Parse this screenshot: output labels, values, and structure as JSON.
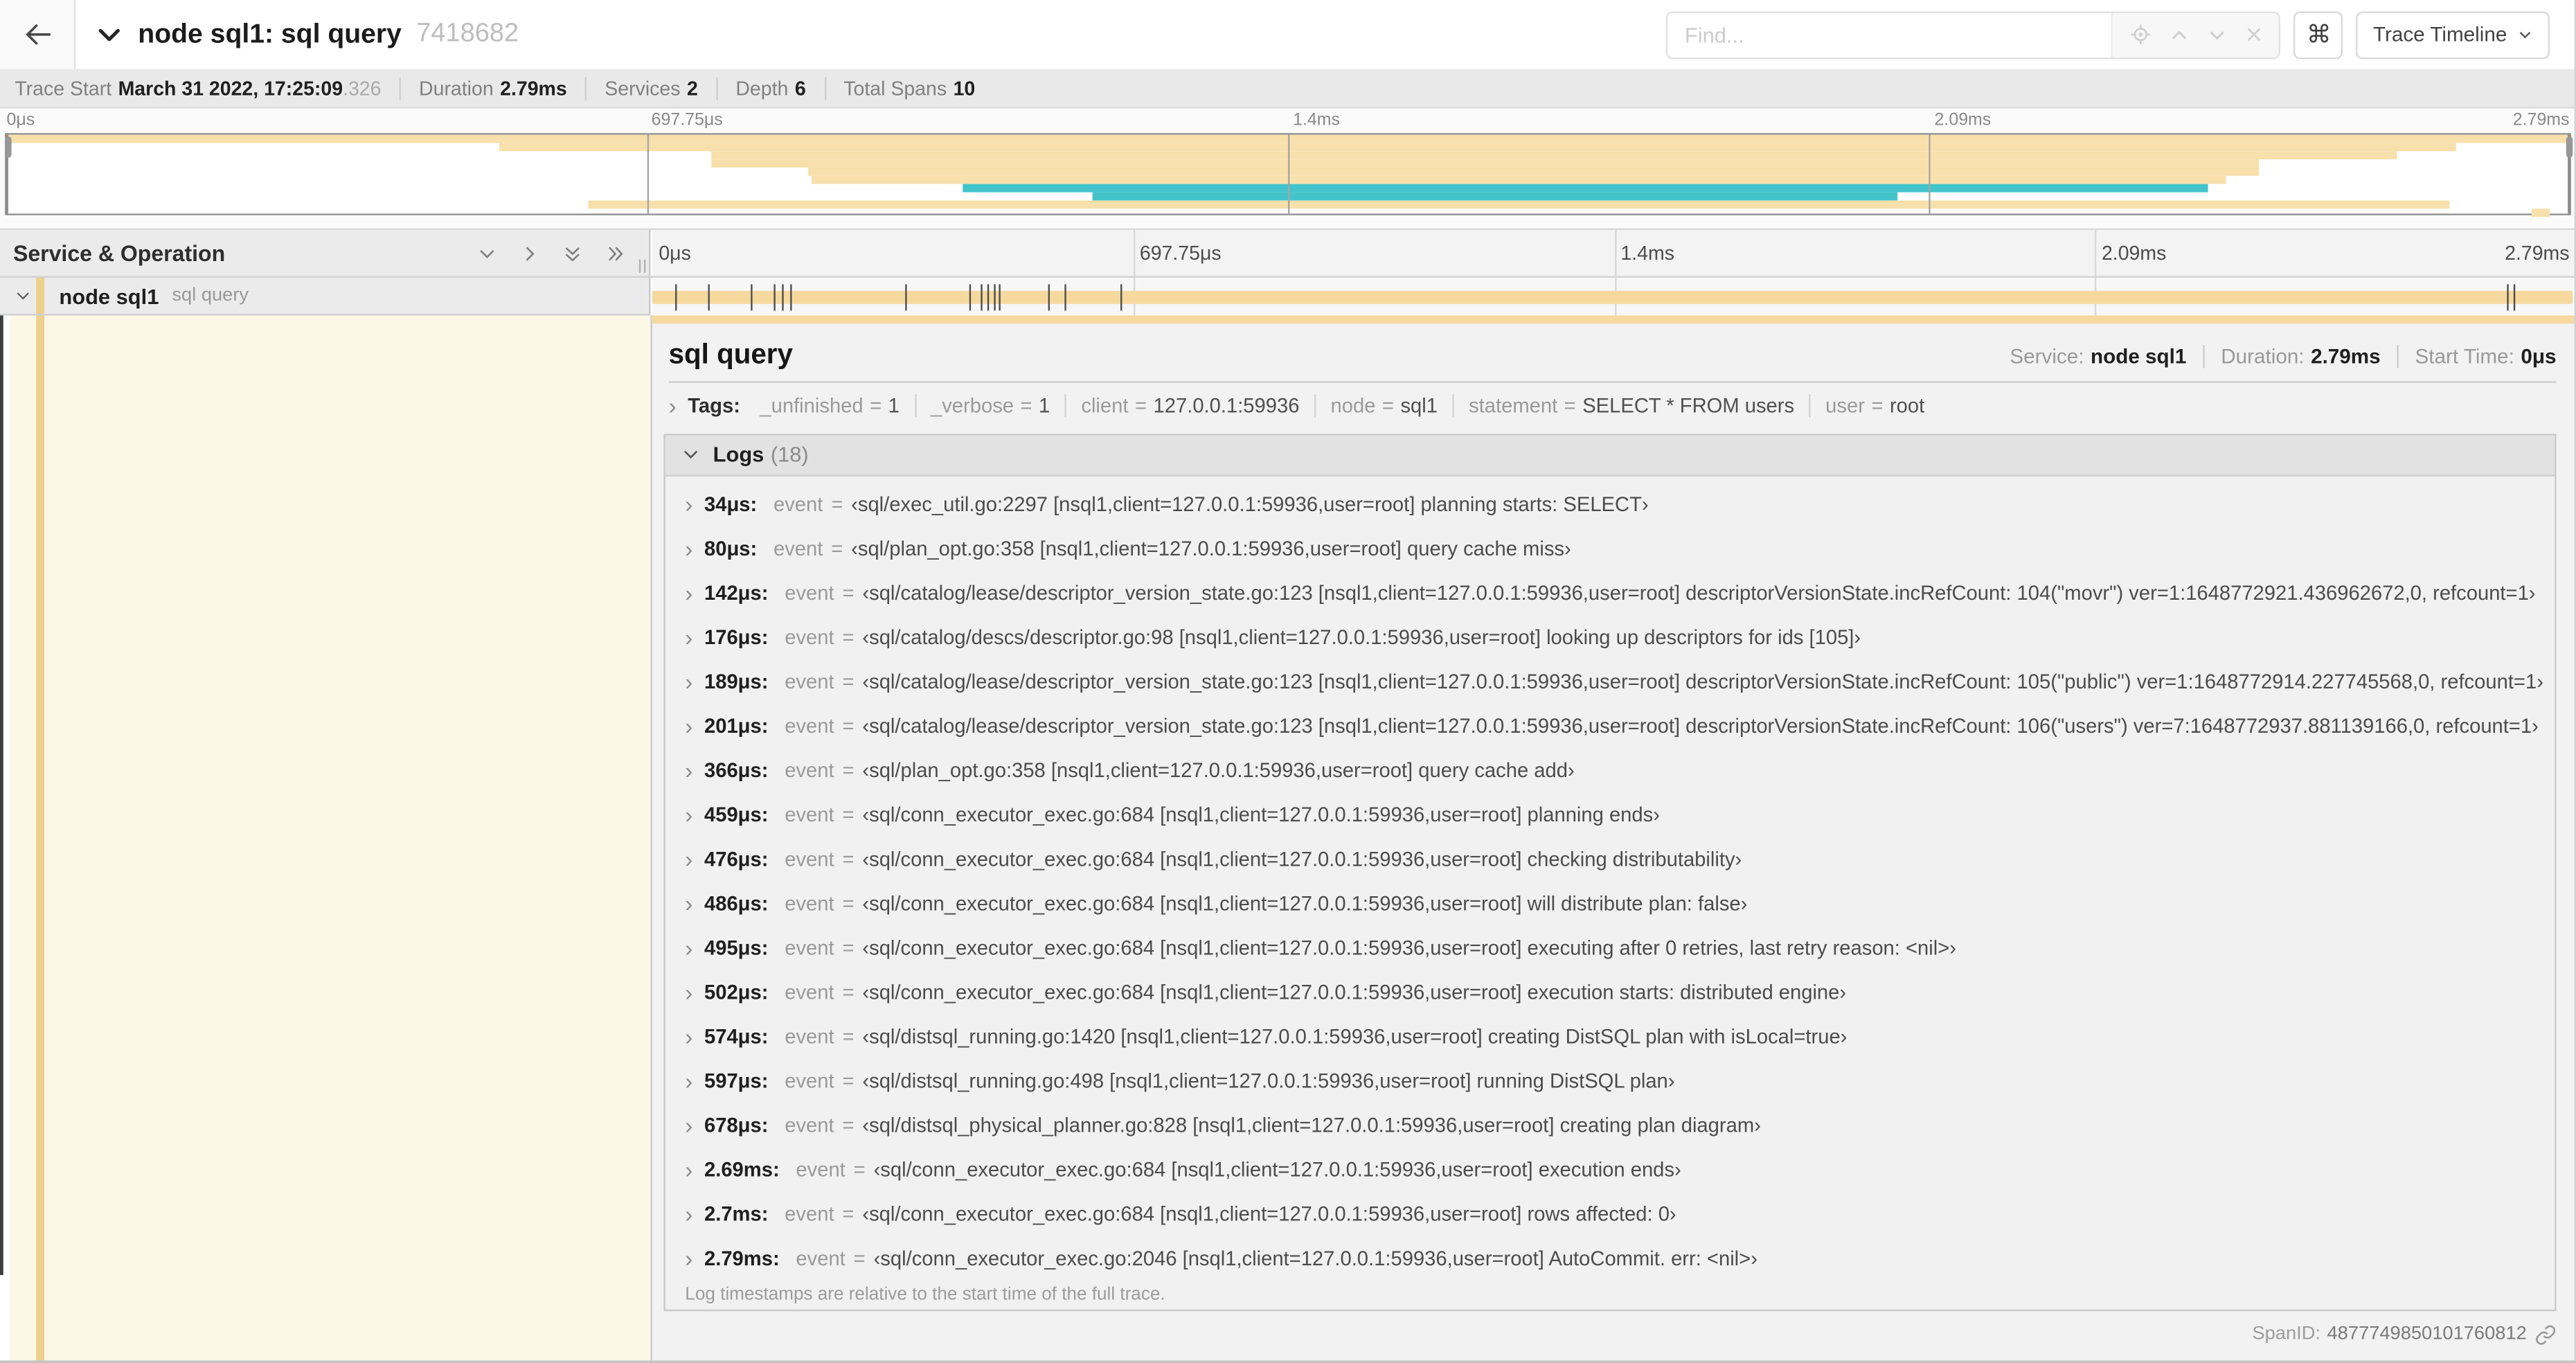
{
  "header": {
    "title": "node sql1: sql query",
    "trace_id": "7418682",
    "find_placeholder": "Find...",
    "view_selector": "Trace Timeline"
  },
  "summary": {
    "trace_start_label": "Trace Start",
    "trace_start_value": "March 31 2022, 17:25:09",
    "trace_start_frac": ".326",
    "duration_label": "Duration",
    "duration_value": "2.79ms",
    "services_label": "Services",
    "services_value": "2",
    "depth_label": "Depth",
    "depth_value": "6",
    "total_spans_label": "Total Spans",
    "total_spans_value": "10"
  },
  "minimap": {
    "labels": [
      "0μs",
      "697.75μs",
      "1.4ms",
      "2.09ms",
      "2.79ms"
    ],
    "spans": [
      {
        "row": 0,
        "start": 0.0,
        "end": 1.0,
        "color": "tan_light"
      },
      {
        "row": 1,
        "start": 0.192,
        "end": 0.956,
        "color": "tan_light"
      },
      {
        "row": 2,
        "start": 0.275,
        "end": 0.933,
        "color": "tan_light"
      },
      {
        "row": 3,
        "start": 0.275,
        "end": 0.879,
        "color": "tan_light"
      },
      {
        "row": 4,
        "start": 0.313,
        "end": 0.879,
        "color": "tan_light"
      },
      {
        "row": 5,
        "start": 0.314,
        "end": 0.866,
        "color": "tan_light"
      },
      {
        "row": 6,
        "start": 0.373,
        "end": 0.859,
        "color": "teal"
      },
      {
        "row": 7,
        "start": 0.424,
        "end": 0.738,
        "color": "teal"
      },
      {
        "row": 8,
        "start": 0.227,
        "end": 0.953,
        "color": "tan_light"
      },
      {
        "row": 9,
        "start": 0.985,
        "end": 0.992,
        "color": "tan_light"
      }
    ]
  },
  "timeline": {
    "labels": [
      "0μs",
      "697.75μs",
      "1.4ms",
      "2.09ms",
      "2.79ms"
    ]
  },
  "left_header": {
    "title": "Service & Operation"
  },
  "row": {
    "service": "node sql1",
    "operation": "sql query",
    "duration_us": 2790,
    "ticks_us": [
      34,
      80,
      142,
      176,
      189,
      201,
      366,
      459,
      476,
      486,
      495,
      502,
      574,
      597,
      678,
      2690,
      2700,
      2790
    ]
  },
  "detail": {
    "title": "sql query",
    "service_label": "Service:",
    "service": "node sql1",
    "duration_label": "Duration:",
    "duration": "2.79ms",
    "start_label": "Start Time:",
    "start": "0μs",
    "tags_label": "Tags:",
    "eq": "=",
    "tags": [
      {
        "key": "_unfinished",
        "value": "1"
      },
      {
        "key": "_verbose",
        "value": "1"
      },
      {
        "key": "client",
        "value": "127.0.0.1:59936"
      },
      {
        "key": "node",
        "value": "sql1"
      },
      {
        "key": "statement",
        "value": "SELECT * FROM users"
      },
      {
        "key": "user",
        "value": "root"
      }
    ],
    "logs_label": "Logs",
    "logs_count": "(18)",
    "logs": [
      {
        "t": "34μs:",
        "key": "event",
        "msg": "‹sql/exec_util.go:2297 [nsql1,client=127.0.0.1:59936,user=root] planning starts: SELECT›"
      },
      {
        "t": "80μs:",
        "key": "event",
        "msg": "‹sql/plan_opt.go:358 [nsql1,client=127.0.0.1:59936,user=root] query cache miss›"
      },
      {
        "t": "142μs:",
        "key": "event",
        "msg": "‹sql/catalog/lease/descriptor_version_state.go:123 [nsql1,client=127.0.0.1:59936,user=root] descriptorVersionState.incRefCount: 104(\"movr\") ver=1:1648772921.436962672,0, refcount=1›"
      },
      {
        "t": "176μs:",
        "key": "event",
        "msg": "‹sql/catalog/descs/descriptor.go:98 [nsql1,client=127.0.0.1:59936,user=root] looking up descriptors for ids [105]›"
      },
      {
        "t": "189μs:",
        "key": "event",
        "msg": "‹sql/catalog/lease/descriptor_version_state.go:123 [nsql1,client=127.0.0.1:59936,user=root] descriptorVersionState.incRefCount: 105(\"public\") ver=1:1648772914.227745568,0, refcount=1›"
      },
      {
        "t": "201μs:",
        "key": "event",
        "msg": "‹sql/catalog/lease/descriptor_version_state.go:123 [nsql1,client=127.0.0.1:59936,user=root] descriptorVersionState.incRefCount: 106(\"users\") ver=7:1648772937.881139166,0, refcount=1›"
      },
      {
        "t": "366μs:",
        "key": "event",
        "msg": "‹sql/plan_opt.go:358 [nsql1,client=127.0.0.1:59936,user=root] query cache add›"
      },
      {
        "t": "459μs:",
        "key": "event",
        "msg": "‹sql/conn_executor_exec.go:684 [nsql1,client=127.0.0.1:59936,user=root] planning ends›"
      },
      {
        "t": "476μs:",
        "key": "event",
        "msg": "‹sql/conn_executor_exec.go:684 [nsql1,client=127.0.0.1:59936,user=root] checking distributability›"
      },
      {
        "t": "486μs:",
        "key": "event",
        "msg": "‹sql/conn_executor_exec.go:684 [nsql1,client=127.0.0.1:59936,user=root] will distribute plan: false›"
      },
      {
        "t": "495μs:",
        "key": "event",
        "msg": "‹sql/conn_executor_exec.go:684 [nsql1,client=127.0.0.1:59936,user=root] executing after 0 retries, last retry reason: <nil>›"
      },
      {
        "t": "502μs:",
        "key": "event",
        "msg": "‹sql/conn_executor_exec.go:684 [nsql1,client=127.0.0.1:59936,user=root] execution starts: distributed engine›"
      },
      {
        "t": "574μs:",
        "key": "event",
        "msg": "‹sql/distsql_running.go:1420 [nsql1,client=127.0.0.1:59936,user=root] creating DistSQL plan with isLocal=true›"
      },
      {
        "t": "597μs:",
        "key": "event",
        "msg": "‹sql/distsql_running.go:498 [nsql1,client=127.0.0.1:59936,user=root] running DistSQL plan›"
      },
      {
        "t": "678μs:",
        "key": "event",
        "msg": "‹sql/distsql_physical_planner.go:828 [nsql1,client=127.0.0.1:59936,user=root] creating plan diagram›"
      },
      {
        "t": "2.69ms:",
        "key": "event",
        "msg": "‹sql/conn_executor_exec.go:684 [nsql1,client=127.0.0.1:59936,user=root] execution ends›"
      },
      {
        "t": "2.7ms:",
        "key": "event",
        "msg": "‹sql/conn_executor_exec.go:684 [nsql1,client=127.0.0.1:59936,user=root] rows affected: 0›"
      },
      {
        "t": "2.79ms:",
        "key": "event",
        "msg": "‹sql/conn_executor_exec.go:2046 [nsql1,client=127.0.0.1:59936,user=root] AutoCommit. err: <nil>›"
      }
    ],
    "logs_note": "Log timestamps are relative to the start time of the full trace.",
    "span_id_label": "SpanID:",
    "span_id": "4877749850101760812"
  },
  "colors": {
    "tan": "#f5d99f",
    "tan_light": "#f7e0ac",
    "teal": "#43c4cb",
    "cream": "#fdf7e7",
    "stripe": "#edd08c"
  }
}
